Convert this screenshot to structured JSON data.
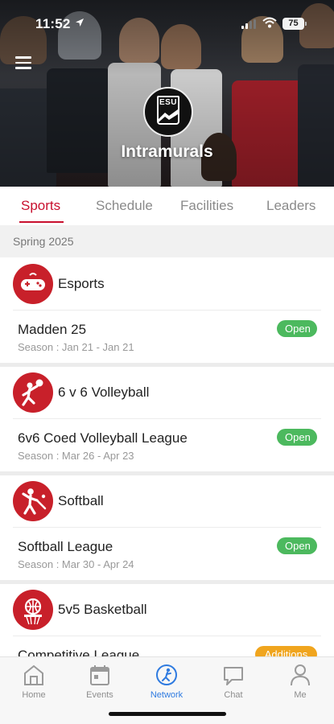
{
  "status_bar": {
    "time": "11:52",
    "battery": "75"
  },
  "header": {
    "title": "Intramurals",
    "logo_text": "ESU"
  },
  "tabs": [
    {
      "label": "Sports",
      "active": true
    },
    {
      "label": "Schedule",
      "active": false
    },
    {
      "label": "Facilities",
      "active": false
    },
    {
      "label": "Leaders",
      "active": false
    }
  ],
  "section": {
    "title": "Spring 2025"
  },
  "sports": [
    {
      "name": "Esports",
      "icon": "gamepad-icon",
      "league": "Madden 25",
      "season": "Season : Jan 21 - Jan 21",
      "status": "Open"
    },
    {
      "name": "6 v 6 Volleyball",
      "icon": "volleyball-icon",
      "league": "6v6 Coed Volleyball League",
      "season": "Season : Mar 26 - Apr 23",
      "status": "Open"
    },
    {
      "name": "Softball",
      "icon": "softball-icon",
      "league": "Softball League",
      "season": "Season : Mar 30 - Apr 24",
      "status": "Open"
    },
    {
      "name": "5v5 Basketball",
      "icon": "basketball-icon",
      "league": "Competitive League",
      "season": "",
      "status": "Additions"
    }
  ],
  "bottom_nav": [
    {
      "label": "Home",
      "icon": "home-icon",
      "active": false
    },
    {
      "label": "Events",
      "icon": "calendar-icon",
      "active": false
    },
    {
      "label": "Network",
      "icon": "network-icon",
      "active": true
    },
    {
      "label": "Chat",
      "icon": "chat-icon",
      "active": false
    },
    {
      "label": "Me",
      "icon": "person-icon",
      "active": false
    }
  ],
  "colors": {
    "accent": "#c8102e",
    "open": "#4cb95e",
    "additions": "#f0a51e",
    "nav_active": "#2f7be0"
  }
}
